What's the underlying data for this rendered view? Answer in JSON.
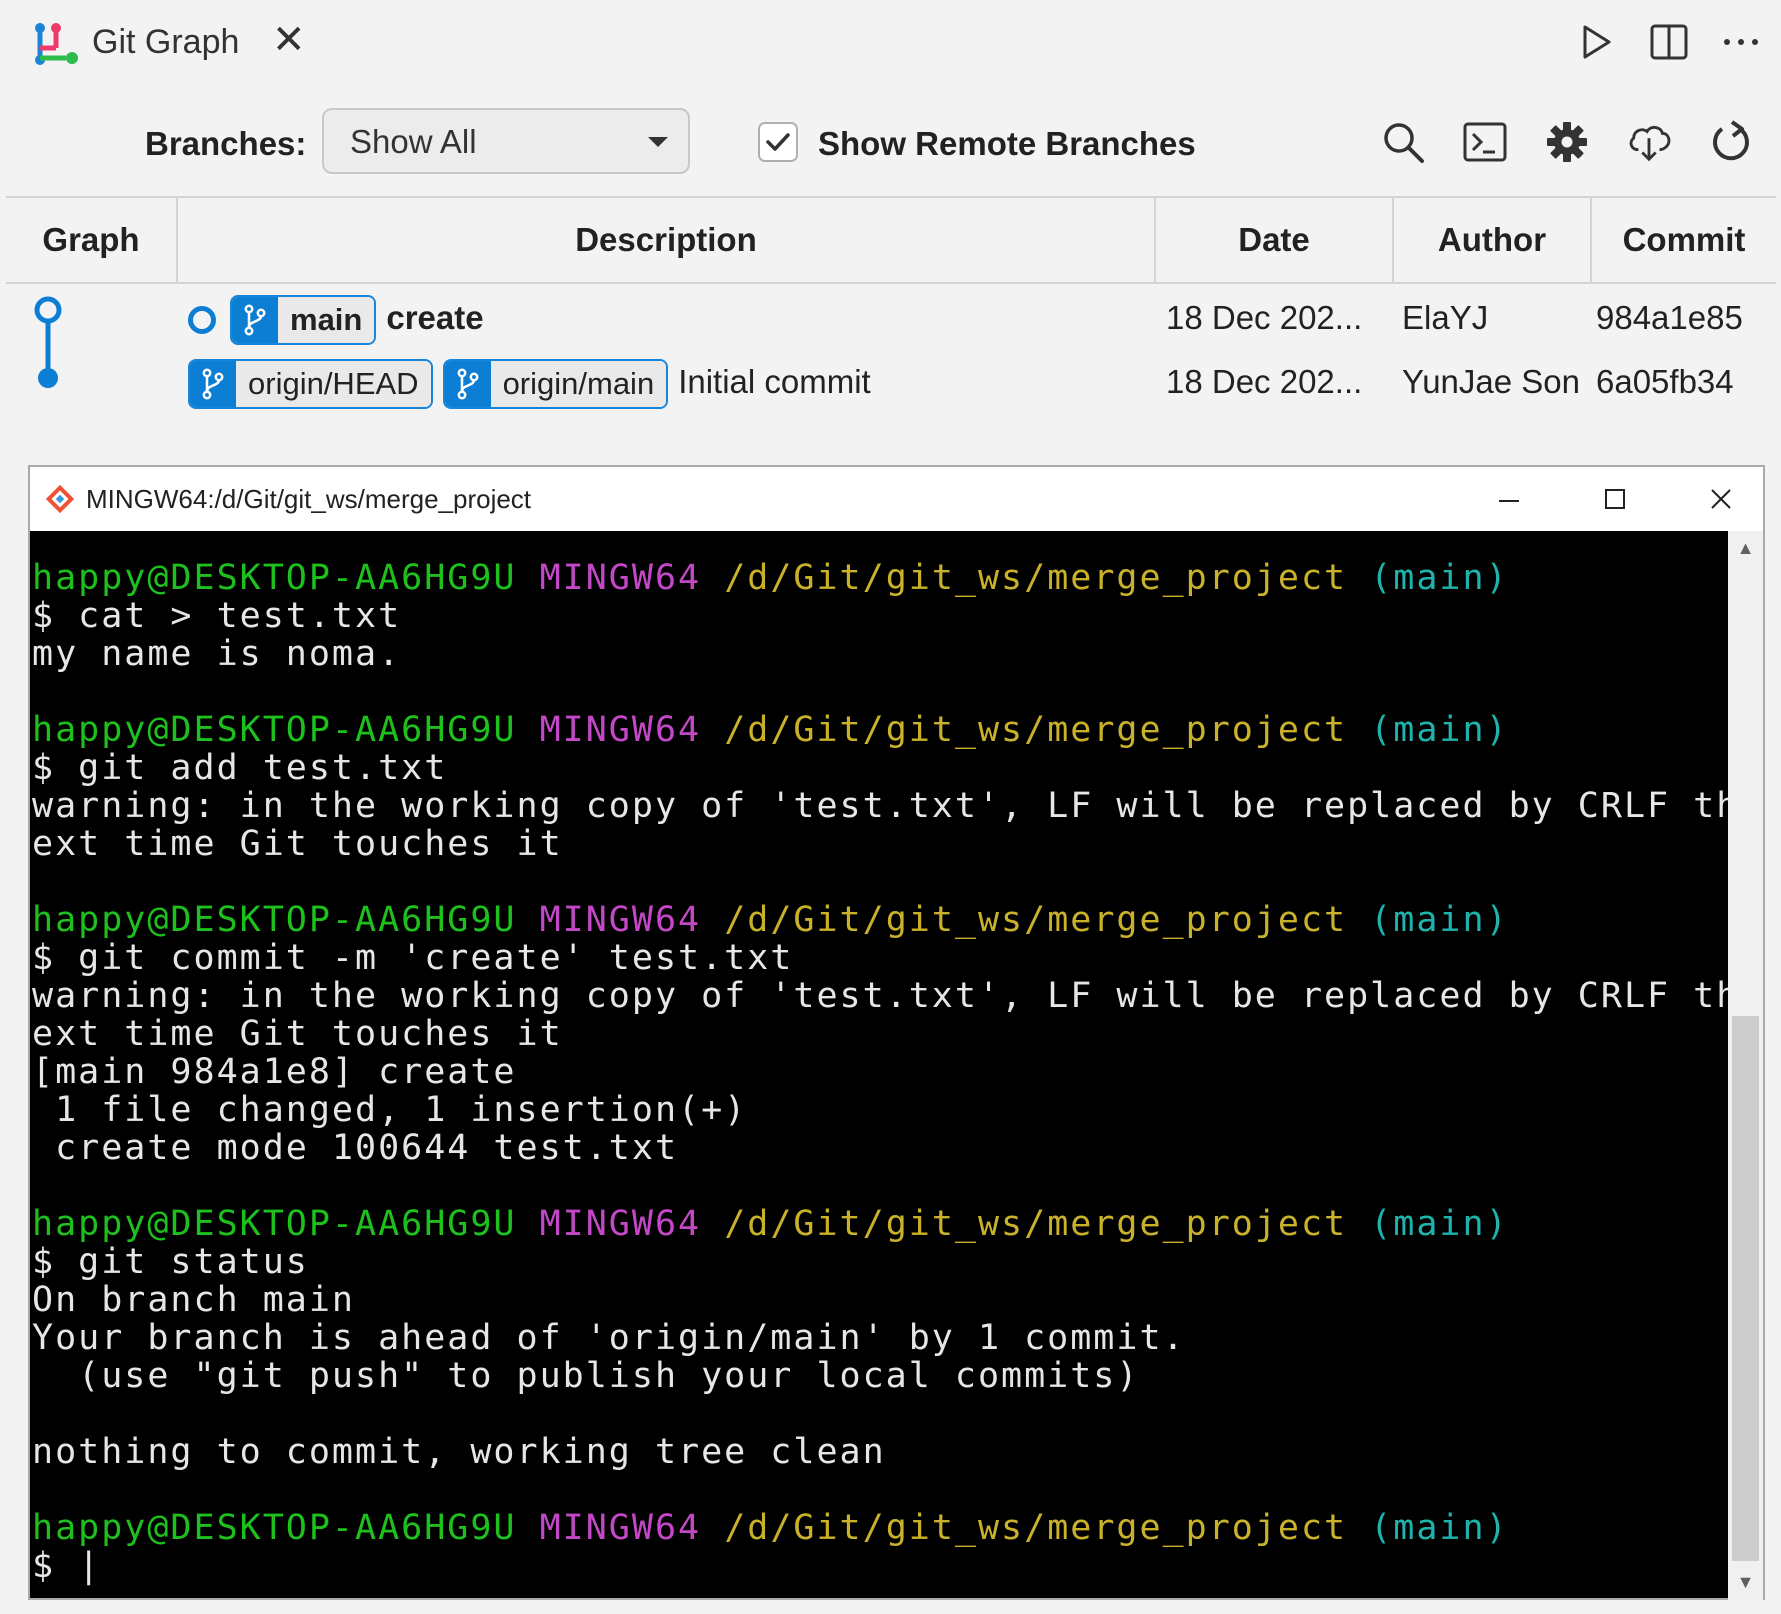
{
  "tab": {
    "title": "Git Graph",
    "close": "✕"
  },
  "controls": {
    "branches_label": "Branches:",
    "branch_selected": "Show All",
    "show_remote_label": "Show Remote Branches",
    "show_remote_checked": true
  },
  "table": {
    "headers": [
      "Graph",
      "Description",
      "Date",
      "Author",
      "Commit"
    ],
    "rows": [
      {
        "refs": [
          "main"
        ],
        "description": "create",
        "date": "18 Dec 202...",
        "author": "ElaYJ",
        "commit": "984a1e85"
      },
      {
        "refs": [
          "origin/HEAD",
          "origin/main"
        ],
        "description": "Initial commit",
        "date": "18 Dec 202...",
        "author": "YunJae Son",
        "commit": "6a05fb34"
      }
    ]
  },
  "terminal": {
    "title": "MINGW64:/d/Git/git_ws/merge_project",
    "prompt": {
      "user": "happy@DESKTOP-AA6HG9U",
      "env": "MINGW64",
      "path": "/d/Git/git_ws/merge_project",
      "branch": "(main)"
    },
    "blocks": [
      {
        "cmd": "$ cat > test.txt",
        "out": [
          "my name is noma."
        ]
      },
      {
        "cmd": "$ git add test.txt",
        "out": [
          "warning: in the working copy of 'test.txt', LF will be replaced by CRLF the n",
          "ext time Git touches it"
        ]
      },
      {
        "cmd": "$ git commit -m 'create' test.txt",
        "out": [
          "warning: in the working copy of 'test.txt', LF will be replaced by CRLF the n",
          "ext time Git touches it",
          "[main 984a1e8] create",
          " 1 file changed, 1 insertion(+)",
          " create mode 100644 test.txt"
        ]
      },
      {
        "cmd": "$ git status",
        "out": [
          "On branch main",
          "Your branch is ahead of 'origin/main' by 1 commit.",
          "  (use \"git push\" to publish your local commits)",
          "",
          "nothing to commit, working tree clean"
        ]
      },
      {
        "cmd": "$ |",
        "out": []
      }
    ]
  },
  "colors": {
    "accent": "#0c7fd4",
    "prompt_user": "#1ec01e",
    "prompt_env": "#c347c6",
    "prompt_path": "#c9b12a",
    "prompt_branch": "#1eb3ad"
  }
}
